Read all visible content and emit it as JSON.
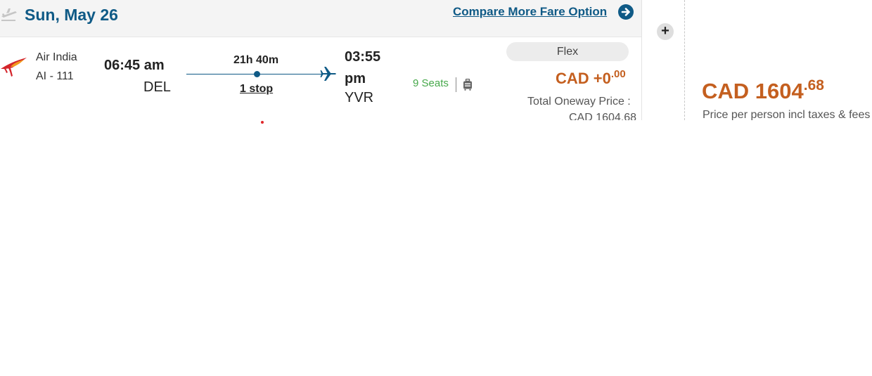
{
  "header": {
    "date": "Sun, May 26",
    "compare_link": "Compare More Fare Option"
  },
  "flight": {
    "airline_name": "Air India",
    "flight_number": "AI - 111",
    "departure": {
      "time": "06:45 am",
      "code": "DEL"
    },
    "arrival": {
      "time": "03:55 pm",
      "code": "YVR"
    },
    "duration": "21h 40m",
    "stops": "1 stop",
    "seats": "9 Seats"
  },
  "fare": {
    "class": "Flex",
    "add_currency": "CAD +0",
    "add_cents": ".00",
    "total_label": "Total Oneway Price :",
    "total_value": "CAD 1604.68"
  },
  "price": {
    "currency_amount": "CAD 1604",
    "cents": ".68",
    "note": "Price per person incl taxes & fees"
  },
  "controls": {
    "expand": "+"
  },
  "icons": {
    "departure": "plane-takeoff-icon",
    "logo": "air-india-logo",
    "arrival": "plane-icon",
    "baggage": "luggage-icon",
    "compare": "arrow-right-circle-icon"
  },
  "colors": {
    "brand": "#0f5a86",
    "price": "#c45f1f",
    "seats": "#46a84a",
    "marker": "#e0262a"
  }
}
